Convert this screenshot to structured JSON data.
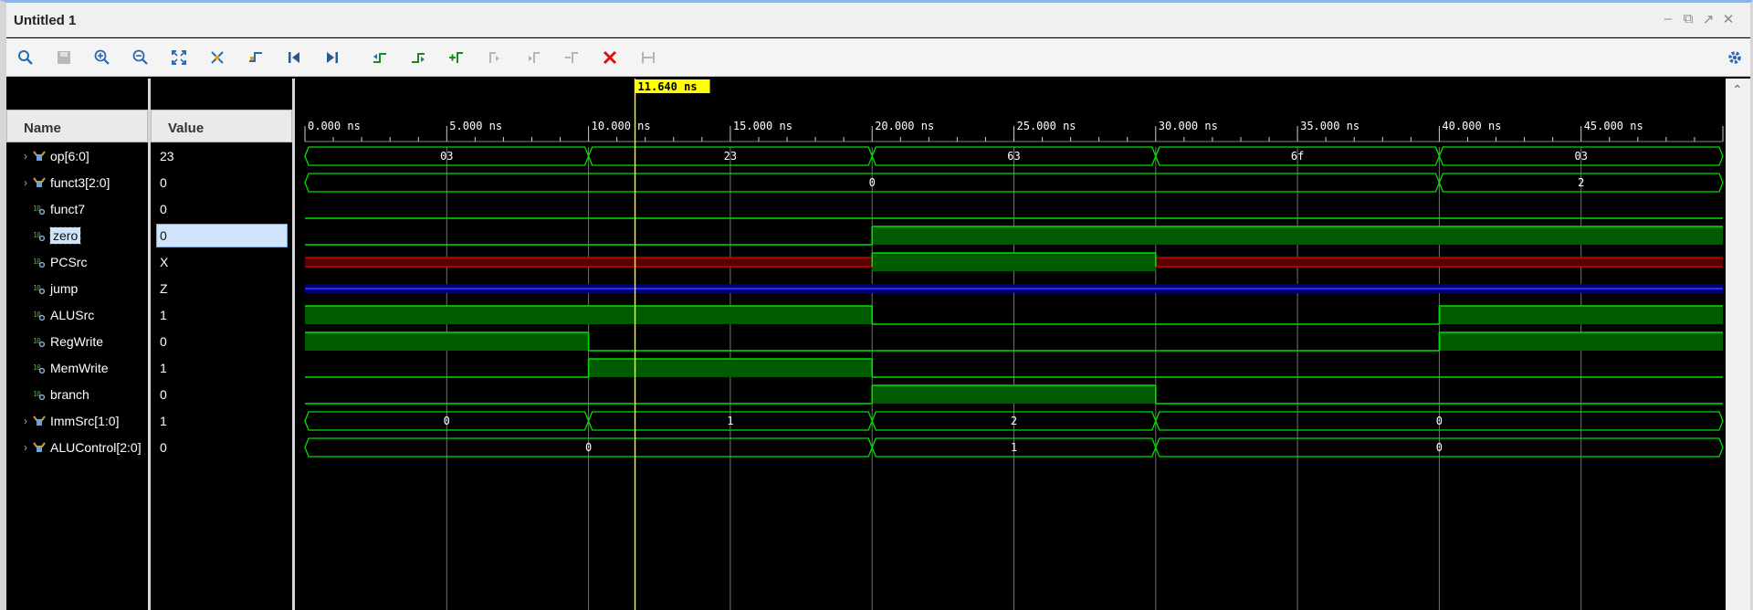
{
  "window": {
    "title": "Untitled 1",
    "controls": [
      "minimize-icon",
      "restore-icon",
      "maximize-icon",
      "close-icon"
    ]
  },
  "toolbar": {
    "buttons": [
      {
        "name": "search-button",
        "icon": "search-icon"
      },
      {
        "name": "save-button",
        "icon": "save-icon"
      },
      {
        "name": "zoom-in-button",
        "icon": "zoom-in-icon"
      },
      {
        "name": "zoom-out-button",
        "icon": "zoom-out-icon"
      },
      {
        "name": "zoom-fit-button",
        "icon": "zoom-fit-icon"
      },
      {
        "name": "zoom-to-cursor-button",
        "icon": "zoom-cursor-icon"
      },
      {
        "name": "go-to-time-zero-button",
        "icon": "go-to-time-icon"
      },
      {
        "name": "go-to-start-button",
        "icon": "go-to-start-icon"
      },
      {
        "name": "go-to-end-button",
        "icon": "go-to-end-icon"
      },
      {
        "name": "previous-transition-button",
        "icon": "previous-transition-icon"
      },
      {
        "name": "next-transition-button",
        "icon": "next-transition-icon"
      },
      {
        "name": "add-marker-button",
        "icon": "add-marker-icon"
      },
      {
        "name": "previous-marker-button",
        "icon": "previous-marker-icon"
      },
      {
        "name": "next-marker-button",
        "icon": "next-marker-icon"
      },
      {
        "name": "swap-cursors-button",
        "icon": "swap-cursors-icon"
      },
      {
        "name": "delete-markers-button",
        "icon": "delete-icon"
      },
      {
        "name": "snap-to-transition-button",
        "icon": "snap-icon"
      }
    ],
    "settings_icon": "gear-icon"
  },
  "columns": {
    "name": "Name",
    "value": "Value"
  },
  "cursor": {
    "time_label": "11.640 ns",
    "time": 11.64
  },
  "timeline": {
    "range_ns": [
      0,
      50
    ],
    "ticks": [
      "0.000 ns",
      "5.000 ns",
      "10.000 ns",
      "15.000 ns",
      "20.000 ns",
      "25.000 ns",
      "30.000 ns",
      "35.000 ns",
      "40.000 ns",
      "45.000 ns"
    ]
  },
  "signals": [
    {
      "name": "op[6:0]",
      "value": "23",
      "kind": "bus",
      "expandable": true,
      "segments": [
        {
          "start": 0,
          "end": 10,
          "label": "03"
        },
        {
          "start": 10,
          "end": 20,
          "label": "23"
        },
        {
          "start": 20,
          "end": 30,
          "label": "63"
        },
        {
          "start": 30,
          "end": 40,
          "label": "6f"
        },
        {
          "start": 40,
          "end": 50,
          "label": "03"
        }
      ]
    },
    {
      "name": "funct3[2:0]",
      "value": "0",
      "kind": "bus",
      "expandable": true,
      "segments": [
        {
          "start": 0,
          "end": 40,
          "label": "0"
        },
        {
          "start": 40,
          "end": 50,
          "label": "2"
        }
      ]
    },
    {
      "name": "funct7",
      "value": "0",
      "kind": "bit",
      "segments": [
        {
          "start": 0,
          "end": 50,
          "v": "0"
        }
      ]
    },
    {
      "name": "zero",
      "value": "0",
      "kind": "bit",
      "selected": true,
      "segments": [
        {
          "start": 0,
          "end": 20,
          "v": "0"
        },
        {
          "start": 20,
          "end": 50,
          "v": "1"
        }
      ]
    },
    {
      "name": "PCSrc",
      "value": "X",
      "kind": "bit",
      "segments": [
        {
          "start": 0,
          "end": 20,
          "v": "X"
        },
        {
          "start": 20,
          "end": 30,
          "v": "1"
        },
        {
          "start": 30,
          "end": 50,
          "v": "X"
        }
      ]
    },
    {
      "name": "jump",
      "value": "Z",
      "kind": "bit",
      "segments": [
        {
          "start": 0,
          "end": 50,
          "v": "Z"
        }
      ]
    },
    {
      "name": "ALUSrc",
      "value": "1",
      "kind": "bit",
      "segments": [
        {
          "start": 0,
          "end": 20,
          "v": "1"
        },
        {
          "start": 20,
          "end": 40,
          "v": "0"
        },
        {
          "start": 40,
          "end": 50,
          "v": "1"
        }
      ]
    },
    {
      "name": "RegWrite",
      "value": "0",
      "kind": "bit",
      "segments": [
        {
          "start": 0,
          "end": 10,
          "v": "1"
        },
        {
          "start": 10,
          "end": 40,
          "v": "0"
        },
        {
          "start": 40,
          "end": 50,
          "v": "1"
        }
      ]
    },
    {
      "name": "MemWrite",
      "value": "1",
      "kind": "bit",
      "segments": [
        {
          "start": 0,
          "end": 10,
          "v": "0"
        },
        {
          "start": 10,
          "end": 20,
          "v": "1"
        },
        {
          "start": 20,
          "end": 50,
          "v": "0"
        }
      ]
    },
    {
      "name": "branch",
      "value": "0",
      "kind": "bit",
      "segments": [
        {
          "start": 0,
          "end": 20,
          "v": "0"
        },
        {
          "start": 20,
          "end": 30,
          "v": "1"
        },
        {
          "start": 30,
          "end": 50,
          "v": "0"
        }
      ]
    },
    {
      "name": "ImmSrc[1:0]",
      "value": "1",
      "kind": "bus",
      "expandable": true,
      "segments": [
        {
          "start": 0,
          "end": 10,
          "label": "0"
        },
        {
          "start": 10,
          "end": 20,
          "label": "1"
        },
        {
          "start": 20,
          "end": 30,
          "label": "2"
        },
        {
          "start": 30,
          "end": 50,
          "label": "0"
        }
      ]
    },
    {
      "name": "ALUControl[2:0]",
      "value": "0",
      "kind": "bus",
      "expandable": true,
      "segments": [
        {
          "start": 0,
          "end": 20,
          "label": "0"
        },
        {
          "start": 20,
          "end": 30,
          "label": "1"
        },
        {
          "start": 30,
          "end": 50,
          "label": "0"
        }
      ]
    }
  ],
  "colors": {
    "wave_green": "#00e000",
    "wave_fill": "#005a00",
    "x_red": "#cc0000",
    "x_fill": "#5a0000",
    "z_blue": "#2a2aff",
    "cursor_yellow": "#ffff00",
    "grid": "#9a9a9a"
  }
}
